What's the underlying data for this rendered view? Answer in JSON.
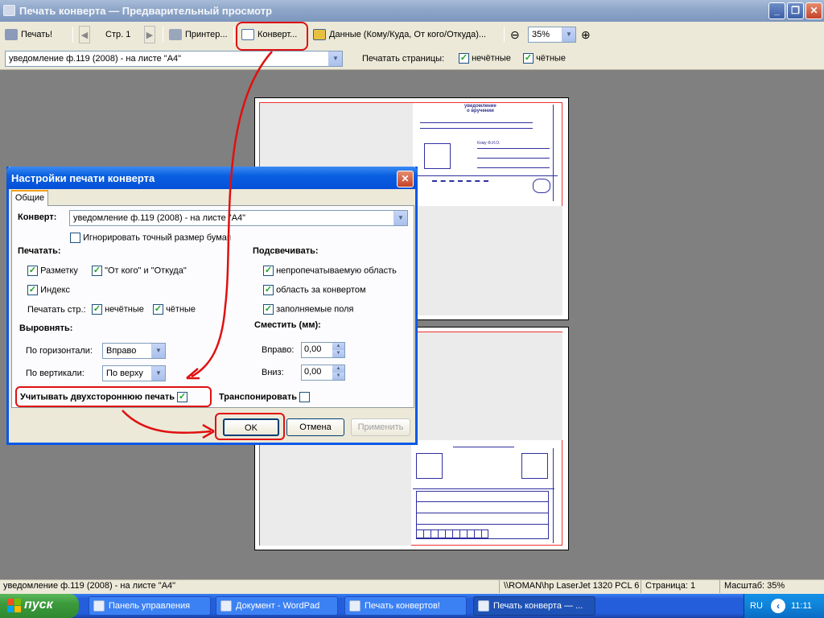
{
  "window": {
    "title": "Печать конверта — Предварительный просмотр",
    "minimize": "_",
    "maximize": "❐",
    "close": "✕"
  },
  "toolbar": {
    "print": "Печать!",
    "page": "Стр. 1",
    "printer": "Принтер...",
    "envelope": "Конверт...",
    "data": "Данные (Кому/Куда, От кого/Откуда)...",
    "zoom": "35%",
    "template": "уведомление ф.119 (2008) - на листе \"А4\"",
    "print_pages_label": "Печатать страницы:",
    "odd": "нечётные",
    "even": "чётные"
  },
  "preview": {
    "form_title": "уведомление\nо вручении",
    "index_label": "Кому Ф.И.О."
  },
  "dialog": {
    "title": "Настройки печати конверта",
    "close": "✕",
    "tab": "Общие",
    "envelope_label": "Конверт:",
    "envelope_value": "уведомление ф.119 (2008) - на листе \"А4\"",
    "ignore_size": "Игнорировать точный размер бумаги",
    "print_heading": "Печатать:",
    "markup": "Разметку",
    "from_where": "\"От кого\" и \"Откуда\"",
    "index": "Индекс",
    "print_pages": "Печатать стр.:",
    "odd": "нечётные",
    "even": "чётные",
    "highlight_heading": "Подсвечивать:",
    "nonprint_area": "непропечатываемую область",
    "outside_area": "область за конвертом",
    "filled_fields": "заполняемые поля",
    "align_heading": "Выровнять:",
    "horizontal": "По горизонтали:",
    "horizontal_value": "Вправо",
    "vertical": "По вертикали:",
    "vertical_value": "По верху",
    "shift_heading": "Сместить (мм):",
    "right": "Вправо:",
    "right_value": "0,00",
    "down": "Вниз:",
    "down_value": "0,00",
    "duplex": "Учитывать двухстороннюю печать",
    "transpose": "Транспонировать",
    "ok": "OK",
    "cancel": "Отмена",
    "apply": "Применить"
  },
  "status": {
    "template": "уведомление ф.119 (2008) - на листе \"А4\"",
    "printer": "\\\\ROMAN\\hp LaserJet 1320 PCL 6",
    "page": "Страница: 1",
    "scale": "Масштаб: 35%"
  },
  "taskbar": {
    "start": "пуск",
    "tasks": [
      "Панель управления",
      "Документ - WordPad",
      "Печать конвертов!",
      "Печать конверта — ..."
    ],
    "lang": "RU",
    "clock": "11:11"
  },
  "colors": {
    "highlight": "#e01010",
    "xp_blue": "#0858e8",
    "checkmark": "#21a121"
  }
}
